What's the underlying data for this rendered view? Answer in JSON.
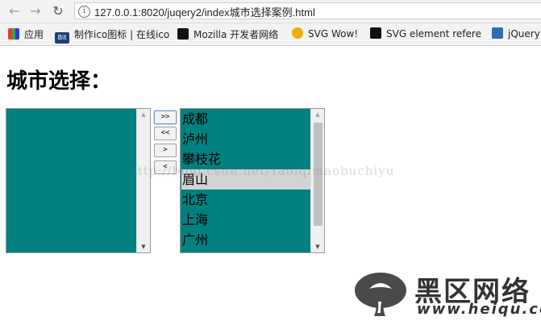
{
  "browser": {
    "url": "127.0.0.1:8020/juqery2/index城市选择案例.html"
  },
  "bookmarks": [
    {
      "label": "应用",
      "icon": "apps-grid-icon"
    },
    {
      "label": "制作ico图标 | 在线ico",
      "icon": "bit-icon"
    },
    {
      "label": "Mozilla 开发者网络",
      "icon": "mozilla-icon"
    },
    {
      "label": "SVG Wow!",
      "icon": "svg-wow-icon"
    },
    {
      "label": "SVG element refere",
      "icon": "svg-element-icon"
    },
    {
      "label": "jQuery",
      "icon": "jquery-icon"
    }
  ],
  "page": {
    "title": "城市选择："
  },
  "left_list": {
    "options": []
  },
  "right_list": {
    "options": [
      "成都",
      "泸州",
      "攀枝花",
      "眉山",
      "北京",
      "上海",
      "广州"
    ],
    "selected_index": 3
  },
  "buttons": {
    "move_all_right": ">>",
    "move_all_left": "<<",
    "move_right": ">",
    "move_left": "<"
  },
  "watermark": "http://blog.csdn.net/Yaoiqimaobuchiyu",
  "brand": {
    "name": "黑区网络",
    "url": "www.heiqu.com"
  },
  "colors": {
    "listbox_bg": "#008080",
    "selected_bg": "#d3d3d3"
  }
}
